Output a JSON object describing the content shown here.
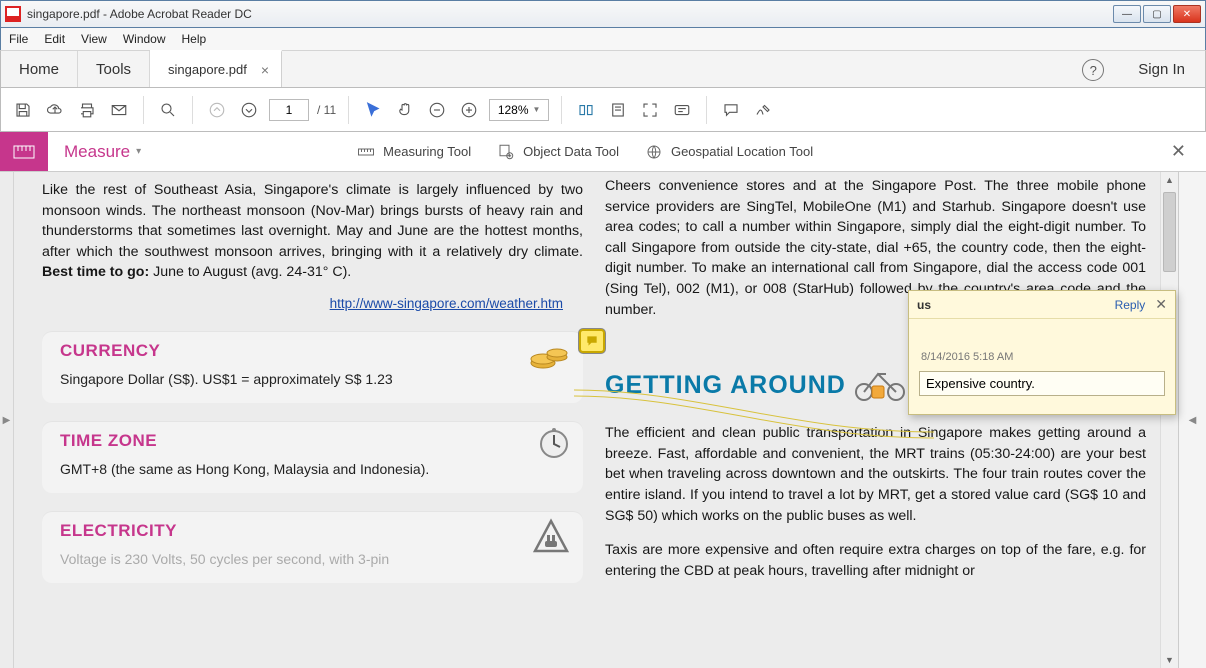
{
  "window": {
    "title": "singapore.pdf - Adobe Acrobat Reader DC"
  },
  "menu": {
    "file": "File",
    "edit": "Edit",
    "view": "View",
    "window": "Window",
    "help": "Help"
  },
  "apptabs": {
    "home": "Home",
    "tools": "Tools",
    "doc": "singapore.pdf",
    "signin": "Sign In"
  },
  "toolbar": {
    "page_current": "1",
    "page_total": "/ 11",
    "zoom": "128%"
  },
  "measurebar": {
    "title": "Measure",
    "measuring": "Measuring Tool",
    "objectdata": "Object Data Tool",
    "geospatial": "Geospatial Location Tool"
  },
  "doc": {
    "left": {
      "climate_para": "Like the rest of Southeast Asia, Singapore's climate is largely influenced by two monsoon winds. The northeast monsoon (Nov-Mar) brings bursts of heavy rain and thunderstorms that sometimes last overnight. May and June are the hottest months, after which the southwest monsoon arrives, bringing with it a relatively dry climate.",
      "best_label": "Best time to go:",
      "best_value": " June to August (avg. 24-31° C).",
      "weather_link": "http://www-singapore.com/weather.htm",
      "currency_h": "CURRENCY",
      "currency_p": "Singapore Dollar (S$). US$1 = approximately S$ 1.23",
      "timezone_h": "TIME ZONE",
      "timezone_p": "GMT+8 (the same as Hong Kong, Malaysia and Indonesia).",
      "electricity_h": "ELECTRICITY",
      "electricity_p": "Voltage is 230 Volts, 50 cycles per second, with 3-pin"
    },
    "right": {
      "phone_para": "Cheers convenience stores and at the Singapore Post. The three mobile phone service providers are SingTel, MobileOne (M1) and Starhub. Singapore doesn't use area codes; to call a number within Singapore, simply dial the eight-digit number. To call Singapore from outside the city-state, dial +65, the country code, then the eight-digit number. To make an international call from Singapore, dial the access code 001 (Sing Tel), 002 (M1), or 008 (StarHub) followed by the country's area code and the number.",
      "getting_h": "GETTING AROUND",
      "transport_para": "The efficient and clean public transportation in Singapore makes getting around a breeze. Fast, affordable and convenient, the MRT trains (05:30-24:00) are your best bet when traveling across downtown and the outskirts. The four train routes cover the entire island. If you intend to travel a lot by MRT, get a stored value card (SG$ 10 and SG$ 50) which works on the public buses as well.",
      "taxi_para": "Taxis are more expensive and often require extra charges on top of the fare, e.g. for entering the CBD at peak hours, travelling after midnight or"
    }
  },
  "comment": {
    "author": "us",
    "reply": "Reply",
    "date": "8/14/2016  5:18 AM",
    "text": "Expensive country."
  }
}
